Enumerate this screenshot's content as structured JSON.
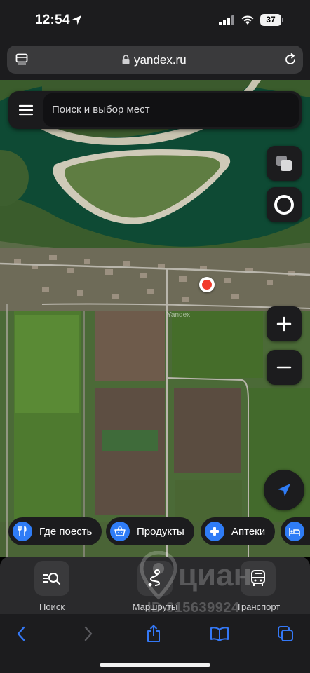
{
  "status_bar": {
    "time": "12:54",
    "battery": "37"
  },
  "browser": {
    "url": "yandex.ru"
  },
  "map": {
    "search_placeholder": "Поиск и выбор мест",
    "map_label": "Yandex",
    "categories": [
      {
        "label": "Где поесть",
        "icon": "fork-knife-icon"
      },
      {
        "label": "Продукты",
        "icon": "basket-icon"
      },
      {
        "label": "Аптеки",
        "icon": "pharmacy-cross-icon"
      },
      {
        "label": "",
        "icon": "bed-icon"
      }
    ]
  },
  "bottom_nav": [
    {
      "label": "Поиск",
      "icon": "search-list-icon"
    },
    {
      "label": "Маршруты",
      "icon": "route-icon"
    },
    {
      "label": "Транспорт",
      "icon": "bus-icon"
    }
  ],
  "watermark": {
    "brand": "циан",
    "id": "ID 315639924"
  },
  "colors": {
    "accent": "#2f7cf6",
    "user_marker": "#f23a2a",
    "panel": "#1c1c1e",
    "safari_blue": "#3478f6"
  }
}
